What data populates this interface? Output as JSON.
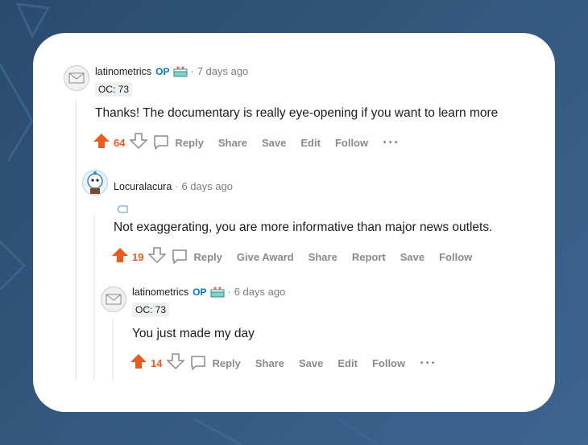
{
  "comments": [
    {
      "username": "latinometrics",
      "op_label": "OP",
      "separator": "·",
      "time": "7 days ago",
      "flair": "OC: 73",
      "body": "Thanks! The documentary is really eye-opening if you want to learn more",
      "votes": "64",
      "actions": [
        "Reply",
        "Share",
        "Save",
        "Edit",
        "Follow"
      ],
      "more": "···"
    },
    {
      "username": "Locuralacura",
      "separator": "·",
      "time": "6 days ago",
      "body": "Not exaggerating, you are more informative than major news outlets.",
      "votes": "19",
      "actions": [
        "Reply",
        "Give Award",
        "Share",
        "Report",
        "Save",
        "Follow"
      ]
    },
    {
      "username": "latinometrics",
      "op_label": "OP",
      "separator": "·",
      "time": "6 days ago",
      "flair": "OC: 73",
      "body": "You just made my day",
      "votes": "14",
      "actions": [
        "Reply",
        "Share",
        "Save",
        "Edit",
        "Follow"
      ],
      "more": "···"
    }
  ],
  "colors": {
    "upvote": "#ee5a1e",
    "op": "#0079d3",
    "muted": "#878a8c",
    "text": "#1c1c1c"
  }
}
